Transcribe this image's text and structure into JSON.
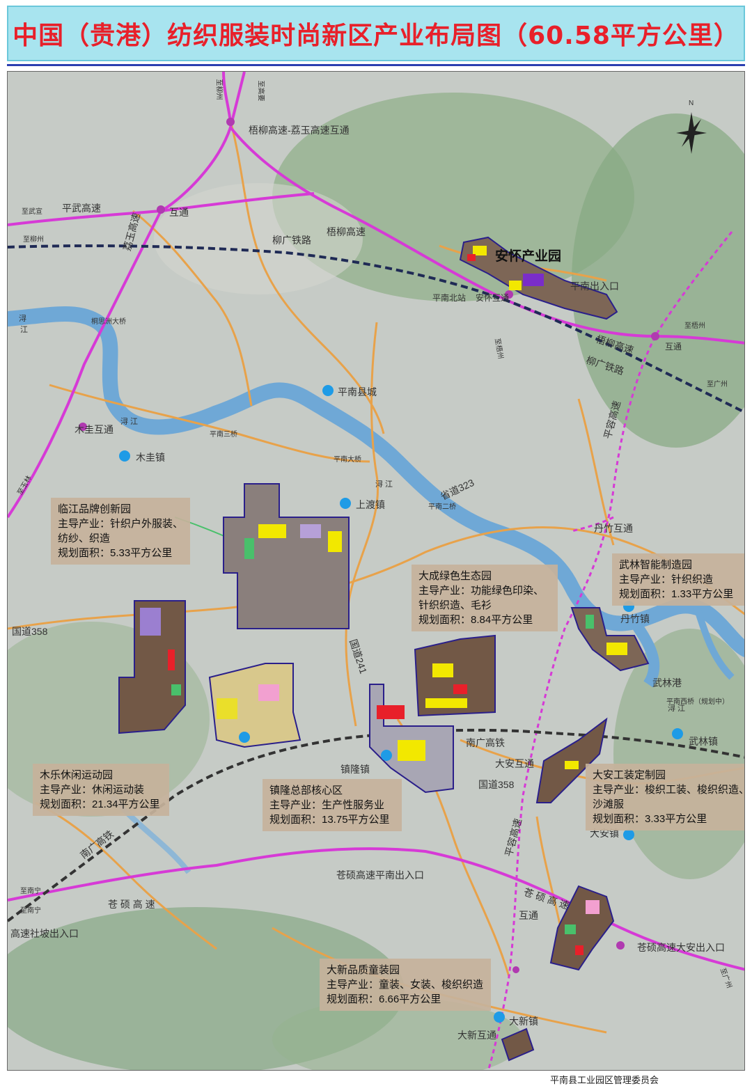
{
  "title": "中国（贵港）纺织服装时尚新区产业布局图（60.58平方公里）",
  "footer": "平南县工业园区管理委员会",
  "compass": "N",
  "colors": {
    "title_text": "#e8202a",
    "title_bg": "#a8e4ef",
    "highway": "#d63ad6",
    "railway": "#1f2a55",
    "river": "#6fa8d6",
    "road": "#e8a24a",
    "park_border": "#2a1f8a",
    "info_bg": "#c5b29b",
    "town_dot": "#1e9be6"
  },
  "parks": [
    {
      "name": "临江品牌创新园",
      "industry": "主导产业：针织户外服装、",
      "industry2": "纺纱、织造",
      "area": "规划面积：5.33平方公里"
    },
    {
      "name": "大成绿色生态园",
      "industry": "主导产业：功能绿色印染、",
      "industry2": "针织织造、毛衫",
      "area": "规划面积：8.84平方公里"
    },
    {
      "name": "武林智能制造园",
      "industry": "主导产业：针织织造",
      "area": "规划面积：1.33平方公里"
    },
    {
      "name": "木乐休闲运动园",
      "industry": "主导产业：休闲运动装",
      "area": "规划面积：21.34平方公里"
    },
    {
      "name": "镇隆总部核心区",
      "industry": "主导产业：生产性服务业",
      "area": "规划面积：13.75平方公里"
    },
    {
      "name": "大安工装定制园",
      "industry": "主导产业：梭织工装、梭织织造、",
      "industry2": "沙滩服",
      "area": "规划面积：3.33平方公里"
    },
    {
      "name": "大新品质童装园",
      "industry": "主导产业：童装、女装、梭织织造",
      "area": "规划面积：6.66平方公里"
    }
  ],
  "labels": {
    "anhuai_park": "安怀产业园",
    "interchange_top": "梧柳高速-荔玉高速互通",
    "hutong1": "互通",
    "pingwu": "平武高速",
    "wuliu1": "梧柳高速",
    "liugui1": "柳广铁路",
    "pingnan_north": "平南北站",
    "anhuai_hutong": "安怀互通",
    "pingnan_exit": "平南出入口",
    "wuliu2": "梧柳高速",
    "hutong2": "互通",
    "liugui2": "柳广铁路",
    "xun1": "浔",
    "jiang1": "江",
    "tongsizhou": "桐思洲大桥",
    "county": "平南县城",
    "mugui_hutong": "木圭互通",
    "mugui_town": "木圭镇",
    "pingnan3": "平南三桥",
    "xunjiang2": "浔 江",
    "pingnan_bridge": "平南大桥",
    "xunjiang3": "浔 江",
    "shangdu": "上渡镇",
    "pingnan2": "平南二桥",
    "sheng323": "省道323",
    "danzhu_hutong": "丹竹互通",
    "danzhu_town": "丹竹镇",
    "wulin_port": "武林港",
    "pingnan_west": "平南西桥（规划中）",
    "xunjiang4": "浔 江",
    "wulin_town": "武林镇",
    "guo358_left": "国道358",
    "guo241": "国道241",
    "nanguang1": "南广高铁",
    "daan_hutong": "大安互通",
    "guo358_right": "国道358",
    "zhenlong": "镇隆镇",
    "daan_town": "大安镇",
    "pingrong1": "平容高速",
    "pingrong2": "平容高速",
    "nanguang2": "南广高铁",
    "cangshuo_pn": "苍硕高速平南出入口",
    "cangshuo1": "苍 硕 高 速",
    "cangshuo2": "苍 硕 高 速",
    "hutong3": "互通",
    "cangshuo_da": "苍硕高速大安出入口",
    "shepo": "高速社坡出入口",
    "daxin_hutong": "大新互通",
    "daxin_town": "大新镇",
    "lizhi": "荔玉高速",
    "to_liuzhou": "至柳州",
    "to_gaoyao": "至高要",
    "to_wuxuan": "至武宣",
    "to_liuzhou2": "至柳州",
    "to_wuzhou": "至梧州",
    "to_guangzhou": "至广州",
    "to_yulin": "至玉林",
    "to_nanning": "至南宁",
    "to_nanning2": "至南宁",
    "to_guangzhou2": "至广州",
    "to_xunzhou": "至梧州"
  }
}
